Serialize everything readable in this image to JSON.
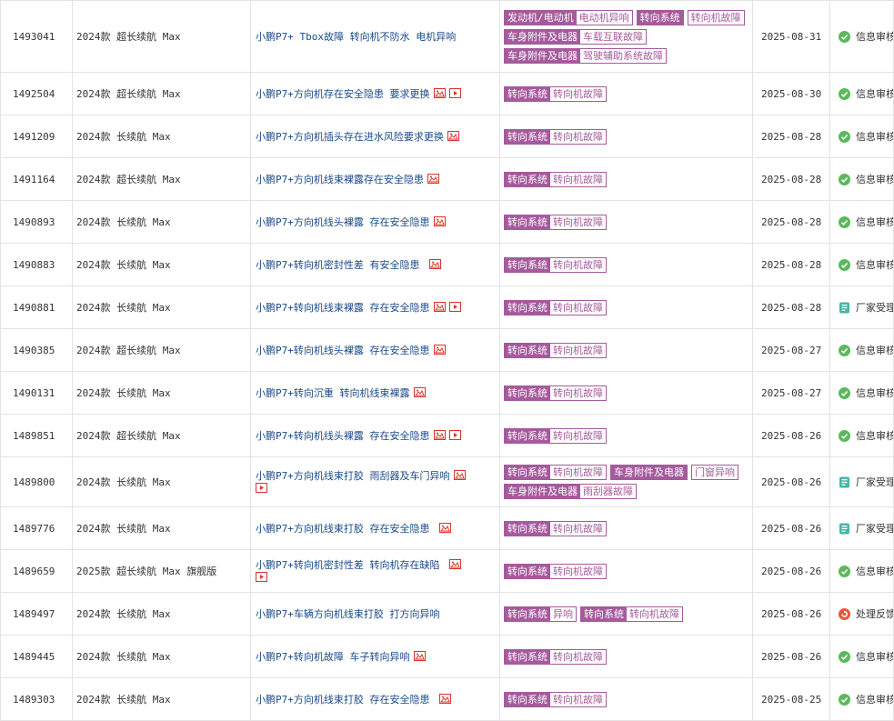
{
  "colors": {
    "tag": "#a55a9c",
    "title_link": "#1a4a8a",
    "approved": "#5cb85c",
    "factory": "#45b6a6",
    "feedback": "#e9553f"
  },
  "rows": [
    {
      "id": "1493041",
      "model": "2024款 超长续航 Max",
      "title": "小鹏P7+ Tbox故障 转向机不防水 电机异响",
      "icons": [],
      "tag_groups": [
        [
          "发动机/电动机",
          "电动机异响"
        ],
        [
          "转向系统"
        ],
        [
          "转向机故障"
        ],
        [
          "车身附件及电器",
          "车载互联故障"
        ],
        [
          "车身附件及电器",
          "驾驶辅助系统故障"
        ]
      ],
      "date": "2025-08-31",
      "status": "信息审核",
      "status_type": "approved"
    },
    {
      "id": "1492504",
      "model": "2024款 超长续航 Max",
      "title": "小鹏P7+方向机存在安全隐患 要求更换",
      "icons": [
        "image-icon",
        "video-icon"
      ],
      "tag_groups": [
        [
          "转向系统",
          "转向机故障"
        ]
      ],
      "date": "2025-08-30",
      "status": "信息审核",
      "status_type": "approved"
    },
    {
      "id": "1491209",
      "model": "2024款 长续航 Max",
      "title": "小鹏P7+方向机插头存在进水风险要求更换",
      "icons": [
        "image-icon"
      ],
      "tag_groups": [
        [
          "转向系统",
          "转向机故障"
        ]
      ],
      "date": "2025-08-28",
      "status": "信息审核",
      "status_type": "approved"
    },
    {
      "id": "1491164",
      "model": "2024款 超长续航 Max",
      "title": "小鹏P7+方向机线束裸露存在安全隐患",
      "icons": [
        "image-icon"
      ],
      "tag_groups": [
        [
          "转向系统",
          "转向机故障"
        ]
      ],
      "date": "2025-08-28",
      "status": "信息审核",
      "status_type": "approved"
    },
    {
      "id": "1490893",
      "model": "2024款 长续航 Max",
      "title": "小鹏P7+方向机线头裸露 存在安全隐患",
      "icons": [
        "image-icon"
      ],
      "tag_groups": [
        [
          "转向系统",
          "转向机故障"
        ]
      ],
      "date": "2025-08-28",
      "status": "信息审核",
      "status_type": "approved"
    },
    {
      "id": "1490883",
      "model": "2024款 长续航 Max",
      "title": "小鹏P7+转向机密封性差 有安全隐患 ",
      "icons": [
        "image-icon"
      ],
      "tag_groups": [
        [
          "转向系统",
          "转向机故障"
        ]
      ],
      "date": "2025-08-28",
      "status": "信息审核",
      "status_type": "approved"
    },
    {
      "id": "1490881",
      "model": "2024款 长续航 Max",
      "title": "小鹏P7+转向机线束裸露 存在安全隐患",
      "icons": [
        "image-icon",
        "video-icon"
      ],
      "tag_groups": [
        [
          "转向系统",
          "转向机故障"
        ]
      ],
      "date": "2025-08-28",
      "status": "厂家受理",
      "status_type": "factory"
    },
    {
      "id": "1490385",
      "model": "2024款 超长续航 Max",
      "title": "小鹏P7+转向机线头裸露 存在安全隐患",
      "icons": [
        "image-icon"
      ],
      "tag_groups": [
        [
          "转向系统",
          "转向机故障"
        ]
      ],
      "date": "2025-08-27",
      "status": "信息审核",
      "status_type": "approved"
    },
    {
      "id": "1490131",
      "model": "2024款 长续航 Max",
      "title": "小鹏P7+转向沉重 转向机线束裸露",
      "icons": [
        "image-icon"
      ],
      "tag_groups": [
        [
          "转向系统",
          "转向机故障"
        ]
      ],
      "date": "2025-08-27",
      "status": "信息审核",
      "status_type": "approved"
    },
    {
      "id": "1489851",
      "model": "2024款 超长续航 Max",
      "title": "小鹏P7+转向机线头裸露 存在安全隐患",
      "icons": [
        "image-icon",
        "video-icon"
      ],
      "tag_groups": [
        [
          "转向系统",
          "转向机故障"
        ]
      ],
      "date": "2025-08-26",
      "status": "信息审核",
      "status_type": "approved"
    },
    {
      "id": "1489800",
      "model": "2024款 长续航 Max",
      "title": "小鹏P7+方向机线束打胶 雨刮器及车门异响",
      "icons": [
        "image-icon",
        "video-icon"
      ],
      "tag_groups": [
        [
          "转向系统",
          "转向机故障"
        ],
        [
          "车身附件及电器"
        ],
        [
          "门窗异响"
        ],
        [
          "车身附件及电器",
          "雨刮器故障"
        ]
      ],
      "date": "2025-08-26",
      "status": "厂家受理",
      "status_type": "factory"
    },
    {
      "id": "1489776",
      "model": "2024款 长续航 Max",
      "title": "小鹏P7+方向机线束打胶 存在安全隐患 ",
      "icons": [
        "image-icon"
      ],
      "tag_groups": [
        [
          "转向系统",
          "转向机故障"
        ]
      ],
      "date": "2025-08-26",
      "status": "厂家受理",
      "status_type": "factory"
    },
    {
      "id": "1489659",
      "model": "2025款 超长续航 Max 旗舰版",
      "title": "小鹏P7+转向机密封性差 转向机存在缺陷 ",
      "icons": [
        "image-icon",
        "video-icon"
      ],
      "tag_groups": [
        [
          "转向系统",
          "转向机故障"
        ]
      ],
      "date": "2025-08-26",
      "status": "信息审核",
      "status_type": "approved"
    },
    {
      "id": "1489497",
      "model": "2024款 长续航 Max",
      "title": "小鹏P7+车辆方向机线束打胶 打方向异响",
      "icons": [],
      "tag_groups": [
        [
          "转向系统",
          "异响"
        ],
        [
          "转向系统",
          "转向机故障"
        ]
      ],
      "date": "2025-08-26",
      "status": "处理反馈",
      "status_type": "feedback"
    },
    {
      "id": "1489445",
      "model": "2024款 长续航 Max",
      "title": "小鹏P7+转向机故障 车子转向异响",
      "icons": [
        "image-icon"
      ],
      "tag_groups": [
        [
          "转向系统",
          "转向机故障"
        ]
      ],
      "date": "2025-08-26",
      "status": "信息审核",
      "status_type": "approved"
    },
    {
      "id": "1489303",
      "model": "2024款 长续航 Max",
      "title": "小鹏P7+方向机线束打胶 存在安全隐患 ",
      "icons": [
        "image-icon"
      ],
      "tag_groups": [
        [
          "转向系统",
          "转向机故障"
        ]
      ],
      "date": "2025-08-25",
      "status": "信息审核",
      "status_type": "approved"
    }
  ]
}
